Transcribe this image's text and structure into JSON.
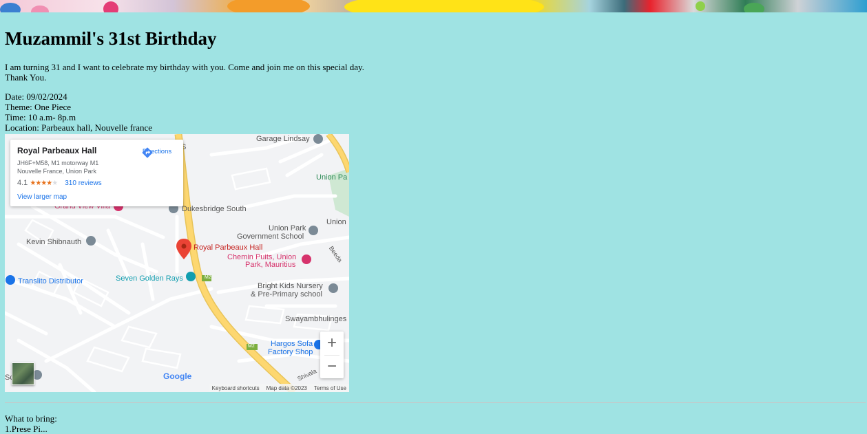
{
  "page": {
    "title": "Muzammil's 31st Birthday",
    "intro_line1": "I am turning 31 and I want to celebrate my birthday with you. Come and join me on this special day.",
    "intro_line2": "Thank You.",
    "details": {
      "date": "Date: 09/02/2024",
      "theme": "Theme: One Piece",
      "time": "Time: 10 a.m- 8p.m",
      "location": "Location: Parbeaux hall, Nouvelle france"
    },
    "bring_heading": "What to bring:",
    "bring_first_item": "1.Prese Pi..."
  },
  "map": {
    "place_name": "Royal Parbeaux Hall",
    "address_line1": "JH6F+M58, M1 motorway M1",
    "address_line2": "Nouvelle France, Union Park",
    "rating": "4.1",
    "stars": "★★★★",
    "star_empty": "★",
    "reviews": "310 reviews",
    "directions_label": "Directions",
    "view_larger": "View larger map",
    "zoom_in": "+",
    "zoom_out": "−",
    "google_logo": "Google",
    "keyboard_shortcuts": "Keyboard shortcuts",
    "map_data": "Map data ©2023",
    "terms": "Terms of Use",
    "pin_label": "Royal Parbeaux Hall",
    "labels": {
      "garage_lindsay": "Garage Lindsay",
      "union_pa": "Union Pa",
      "dukesbridge": "Dukesbridge South",
      "grand_view": "Grand View Villa",
      "union_park_school_1": "Union Park",
      "union_park_school_2": "Government School",
      "union": "Union",
      "kevin": "Kevin Shibnauth",
      "chemin_1": "Chemin Puits, Union",
      "chemin_2": "Park, Mauritius",
      "translito": "Translito Distributor",
      "seven_golden": "Seven Golden Rays",
      "bright_1": "Bright Kids Nursery",
      "bright_2": "& Pre-Primary school",
      "swayam": "Swayambhulinges",
      "hargos_1": "Hargos Sofa",
      "hargos_2": "Factory Shop",
      "beedal": "Beeda",
      "shivala": "Shivala",
      "m2": "M2",
      "s_label": "S",
      "sc_label": "Sc"
    }
  },
  "colors": {
    "background": "#9fe3e3",
    "map_road_major": "#fdd770",
    "link_blue": "#1a73e8",
    "pin_red": "#ea4335",
    "poi_pink": "#d6336c",
    "poi_blue": "#1a73e8",
    "poi_teal": "#129eaf"
  }
}
